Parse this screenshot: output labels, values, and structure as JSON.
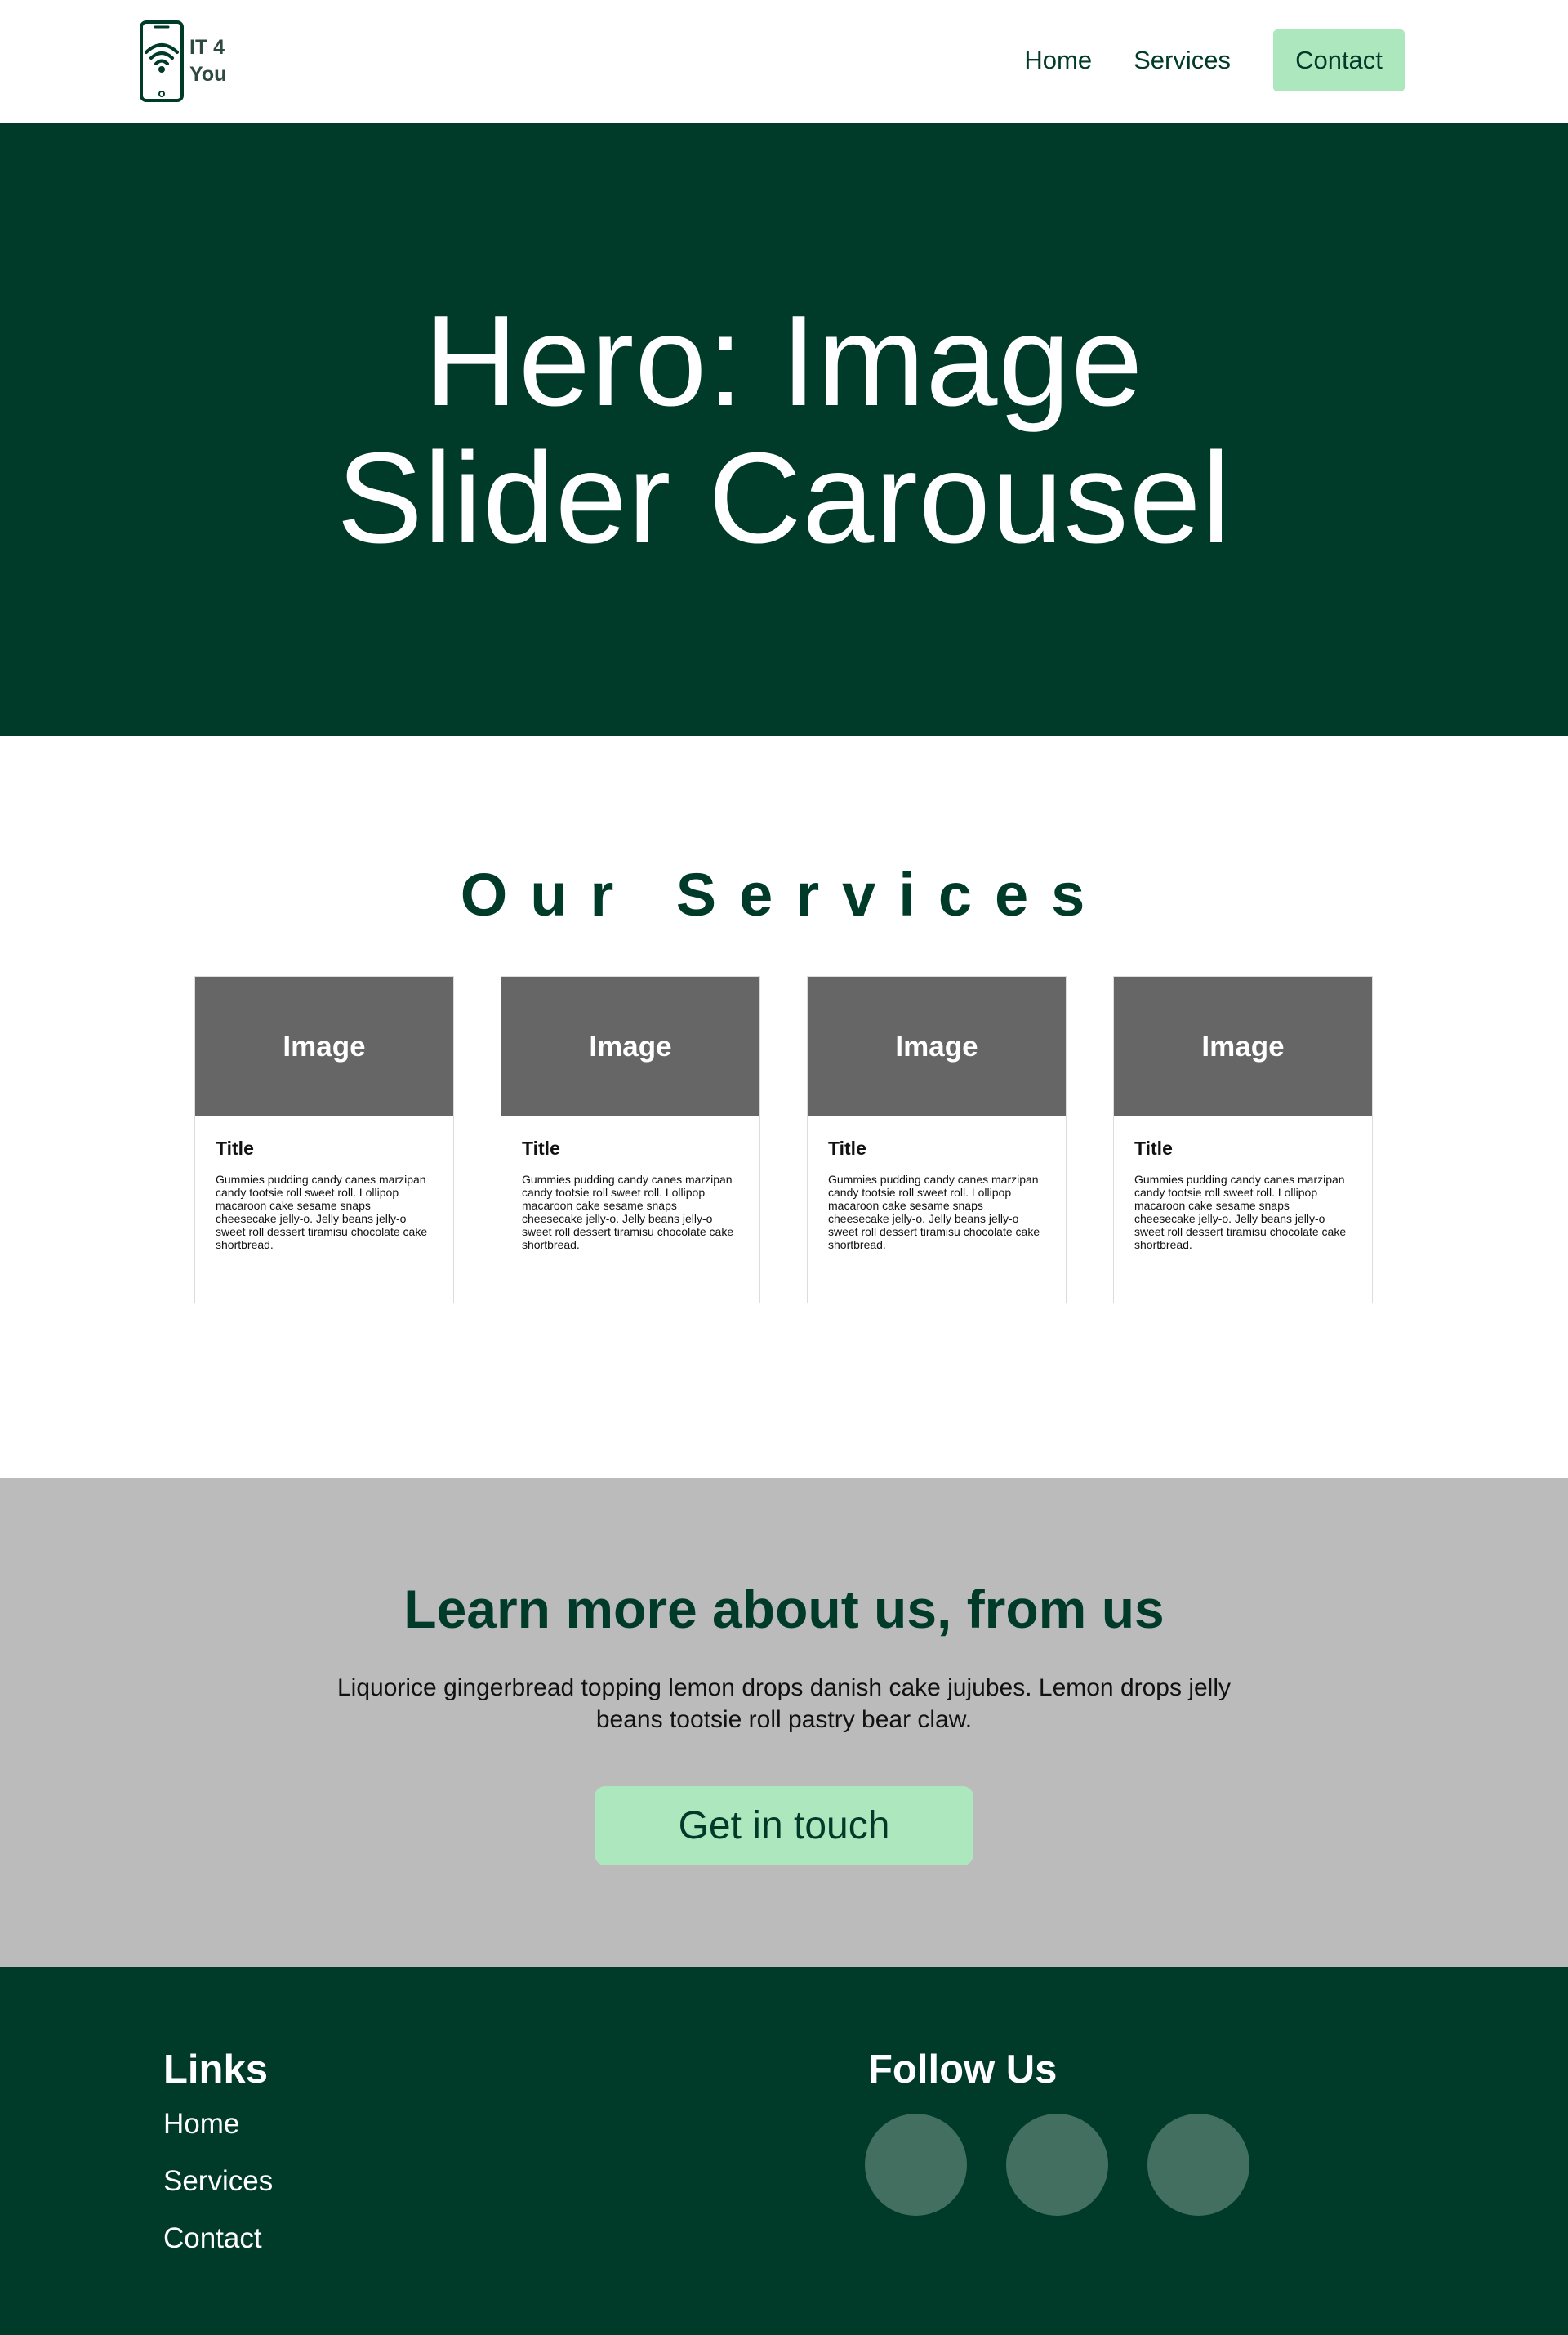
{
  "header": {
    "logo_line1": "IT 4",
    "logo_line2": "You",
    "nav": {
      "home": "Home",
      "services": "Services",
      "contact": "Contact"
    }
  },
  "hero": {
    "title": "Hero: Image Slider Carousel"
  },
  "services": {
    "heading": "Our Services",
    "cards": [
      {
        "image_label": "Image",
        "title": "Title",
        "text": "Gummies pudding candy canes marzipan candy tootsie roll sweet roll. Lollipop macaroon cake sesame snaps cheesecake jelly-o. Jelly beans jelly-o sweet roll dessert tiramisu chocolate cake shortbread."
      },
      {
        "image_label": "Image",
        "title": "Title",
        "text": "Gummies pudding candy canes marzipan candy tootsie roll sweet roll. Lollipop macaroon cake sesame snaps cheesecake jelly-o. Jelly beans jelly-o sweet roll dessert tiramisu chocolate cake shortbread."
      },
      {
        "image_label": "Image",
        "title": "Title",
        "text": "Gummies pudding candy canes marzipan candy tootsie roll sweet roll. Lollipop macaroon cake sesame snaps cheesecake jelly-o. Jelly beans jelly-o sweet roll dessert tiramisu chocolate cake shortbread."
      },
      {
        "image_label": "Image",
        "title": "Title",
        "text": "Gummies pudding candy canes marzipan candy tootsie roll sweet roll. Lollipop macaroon cake sesame snaps cheesecake jelly-o. Jelly beans jelly-o sweet roll dessert tiramisu chocolate cake shortbread."
      }
    ]
  },
  "about": {
    "heading": "Learn more about us, from us",
    "text": "Liquorice gingerbread topping lemon drops danish cake jujubes. Lemon drops jelly beans tootsie roll pastry bear claw.",
    "cta_label": "Get in touch"
  },
  "footer": {
    "links_heading": "Links",
    "links": [
      "Home",
      "Services",
      "Contact"
    ],
    "follow_heading": "Follow Us",
    "social_icons": [
      "social-icon",
      "social-icon",
      "social-icon"
    ]
  },
  "colors": {
    "brand_dark_green": "#003a28",
    "accent_mint": "#ade7bd",
    "placeholder_gray": "#666666",
    "about_bg": "#bbbbbb",
    "social_circle": "#436f61"
  }
}
